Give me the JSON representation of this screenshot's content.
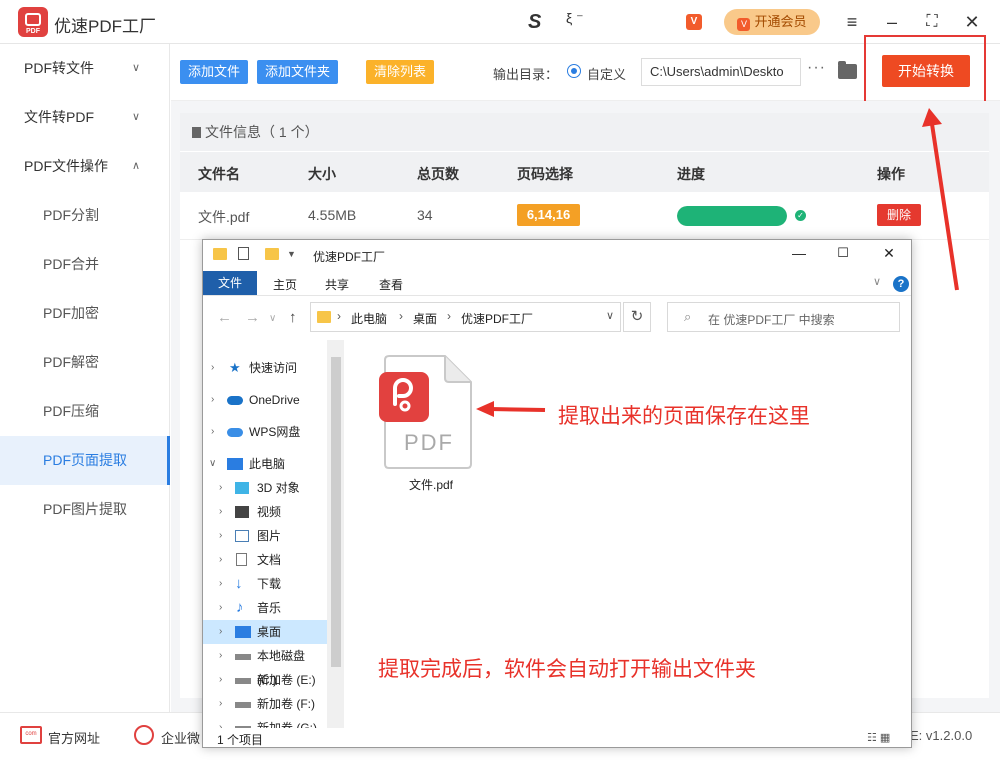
{
  "app": {
    "title": "优速PDF工厂",
    "logo_text": "PDF",
    "brand_mark": "S",
    "brand_tail": "ξ ⁻",
    "vip_label": "开通会员",
    "window_controls": [
      "menu-icon",
      "minimize-icon",
      "fullscreen-icon",
      "close-icon"
    ]
  },
  "sidebar": {
    "items": [
      {
        "label": "PDF转文件",
        "type": "group",
        "expanded": false
      },
      {
        "label": "文件转PDF",
        "type": "group",
        "expanded": false
      },
      {
        "label": "PDF文件操作",
        "type": "group",
        "expanded": true
      },
      {
        "label": "PDF分割",
        "type": "sub"
      },
      {
        "label": "PDF合并",
        "type": "sub"
      },
      {
        "label": "PDF加密",
        "type": "sub"
      },
      {
        "label": "PDF解密",
        "type": "sub"
      },
      {
        "label": "PDF压缩",
        "type": "sub"
      },
      {
        "label": "PDF页面提取",
        "type": "sub",
        "active": true
      },
      {
        "label": "PDF图片提取",
        "type": "sub"
      }
    ]
  },
  "toolbar": {
    "add_file": "添加文件",
    "add_folder": "添加文件夹",
    "clear_list": "清除列表",
    "output_label": "输出目录：",
    "radio_label": "自定义",
    "output_path": "C:\\Users\\admin\\Deskto",
    "more": "···",
    "start": "开始转换"
  },
  "file_table": {
    "info_title": "文件信息（ 1 个）",
    "headers": [
      "文件名",
      "大小",
      "总页数",
      "页码选择",
      "进度",
      "操作"
    ],
    "rows": [
      {
        "name": "文件.pdf",
        "size": "4.55MB",
        "pages": "34",
        "page_select": "6,14,16",
        "progress": 1.0,
        "action": "删除"
      }
    ]
  },
  "footer": {
    "site_icon_text": "com",
    "site_link": "官方网址",
    "wecom_link": "企业微",
    "version": "v1.2.0.0",
    "version_prefix": "E:"
  },
  "explorer": {
    "title": "优速PDF工厂",
    "ribbon_tabs": [
      "文件",
      "主页",
      "共享",
      "查看"
    ],
    "breadcrumbs": [
      "此电脑",
      "桌面",
      "优速PDF工厂"
    ],
    "search_placeholder": "在 优速PDF工厂 中搜索",
    "tree": [
      {
        "label": "快速访问",
        "level": 0,
        "icon": "star-icon"
      },
      {
        "label": "OneDrive",
        "level": 0,
        "icon": "cloud-icon"
      },
      {
        "label": "WPS网盘",
        "level": 0,
        "icon": "cloud-icon"
      },
      {
        "label": "此电脑",
        "level": 0,
        "icon": "pc-icon",
        "expanded": true
      },
      {
        "label": "3D 对象",
        "level": 1,
        "icon": "cube-icon"
      },
      {
        "label": "视频",
        "level": 1,
        "icon": "video-icon"
      },
      {
        "label": "图片",
        "level": 1,
        "icon": "picture-icon"
      },
      {
        "label": "文档",
        "level": 1,
        "icon": "document-icon"
      },
      {
        "label": "下载",
        "level": 1,
        "icon": "download-icon"
      },
      {
        "label": "音乐",
        "level": 1,
        "icon": "music-icon"
      },
      {
        "label": "桌面",
        "level": 1,
        "icon": "desktop-icon",
        "selected": true
      },
      {
        "label": "本地磁盘 (C:)",
        "level": 1,
        "icon": "disk-icon"
      },
      {
        "label": "新加卷 (E:)",
        "level": 1,
        "icon": "disk-icon"
      },
      {
        "label": "新加卷 (F:)",
        "level": 1,
        "icon": "disk-icon"
      },
      {
        "label": "新加卷 (G:)",
        "level": 1,
        "icon": "disk-icon"
      }
    ],
    "file": {
      "name": "文件.pdf",
      "icon_label": "PDF"
    },
    "status": "1 个项目"
  },
  "annotations": {
    "arrow_text": "提取出来的页面保存在这里",
    "bottom_text": "提取完成后，软件会自动打开输出文件夹"
  },
  "colors": {
    "accent_blue": "#3b8ff0",
    "clear_orange": "#fbb22a",
    "start_red": "#ee4a22",
    "progress_green": "#1eb377",
    "annotation_red": "#e8322a",
    "badge_orange": "#f4a025"
  }
}
